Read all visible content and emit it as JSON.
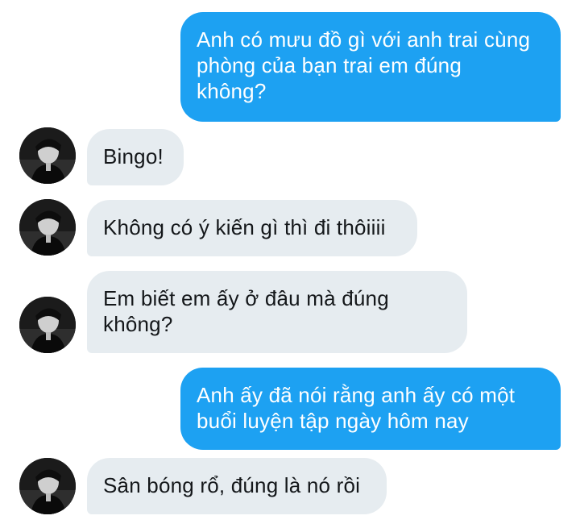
{
  "colors": {
    "sent_bubble": "#1da1f2",
    "received_bubble": "#e6ecf0"
  },
  "messages": [
    {
      "direction": "sent",
      "text": "Anh có mưu đồ gì với anh trai cùng\nphòng của bạn trai em đúng\nkhông?"
    },
    {
      "direction": "received",
      "avatar_icon": "profile-photo-avatar",
      "text": "Bingo!"
    },
    {
      "direction": "received",
      "avatar_icon": "profile-photo-avatar",
      "text": "Không có ý kiến gì thì đi thôiiii"
    },
    {
      "direction": "received",
      "avatar_icon": "profile-photo-avatar",
      "text": "Em biết em ấy ở đâu mà đúng\nkhông?"
    },
    {
      "direction": "sent",
      "text": "Anh ấy đã nói rằng anh ấy có một\nbuổi luyện tập ngày hôm nay"
    },
    {
      "direction": "received",
      "avatar_icon": "profile-photo-avatar",
      "text": "Sân bóng rổ, đúng là nó rồi"
    }
  ]
}
